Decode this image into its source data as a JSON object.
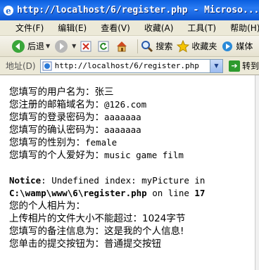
{
  "window": {
    "title": "http://localhost/6/register.php - Microso..."
  },
  "menu": {
    "items": [
      "文件(F)",
      "编辑(E)",
      "查看(V)",
      "收藏(A)",
      "工具(T)",
      "帮助(H)"
    ]
  },
  "toolbar": {
    "back_label": "后退",
    "search_label": "搜索",
    "favorites_label": "收藏夹",
    "media_label": "媒体"
  },
  "address": {
    "label": "地址(D)",
    "url": "http://localhost/6/register.php",
    "go_label": "转到"
  },
  "content": {
    "lines": [
      {
        "label": "您填写的用户名为：",
        "value": "张三"
      },
      {
        "label": "您注册的邮箱域名为：",
        "value": "@126.com"
      },
      {
        "label": "您填写的登录密码为：",
        "value": "aaaaaaa"
      },
      {
        "label": "您填写的确认密码为：",
        "value": "aaaaaaa"
      },
      {
        "label": "您填写的性别为：",
        "value": "female"
      },
      {
        "label": "您填写的个人爱好为：",
        "value": "music game film"
      }
    ],
    "notice": {
      "prefix": "Notice",
      "message": ": Undefined index: myPicture in",
      "file": "C:\\wamp\\www\\6\\register.php",
      "on_line": " on line ",
      "line_number": "17"
    },
    "after": [
      "您的个人相片为：",
      "上传相片的文件大小不能超过：1024字节",
      "您填写的备注信息为：这是我的个人信息!",
      "您单击的提交按钮为：普通提交按钮"
    ]
  },
  "colors": {
    "titlebar": "#0a5fe0",
    "chrome": "#ece9d8"
  }
}
